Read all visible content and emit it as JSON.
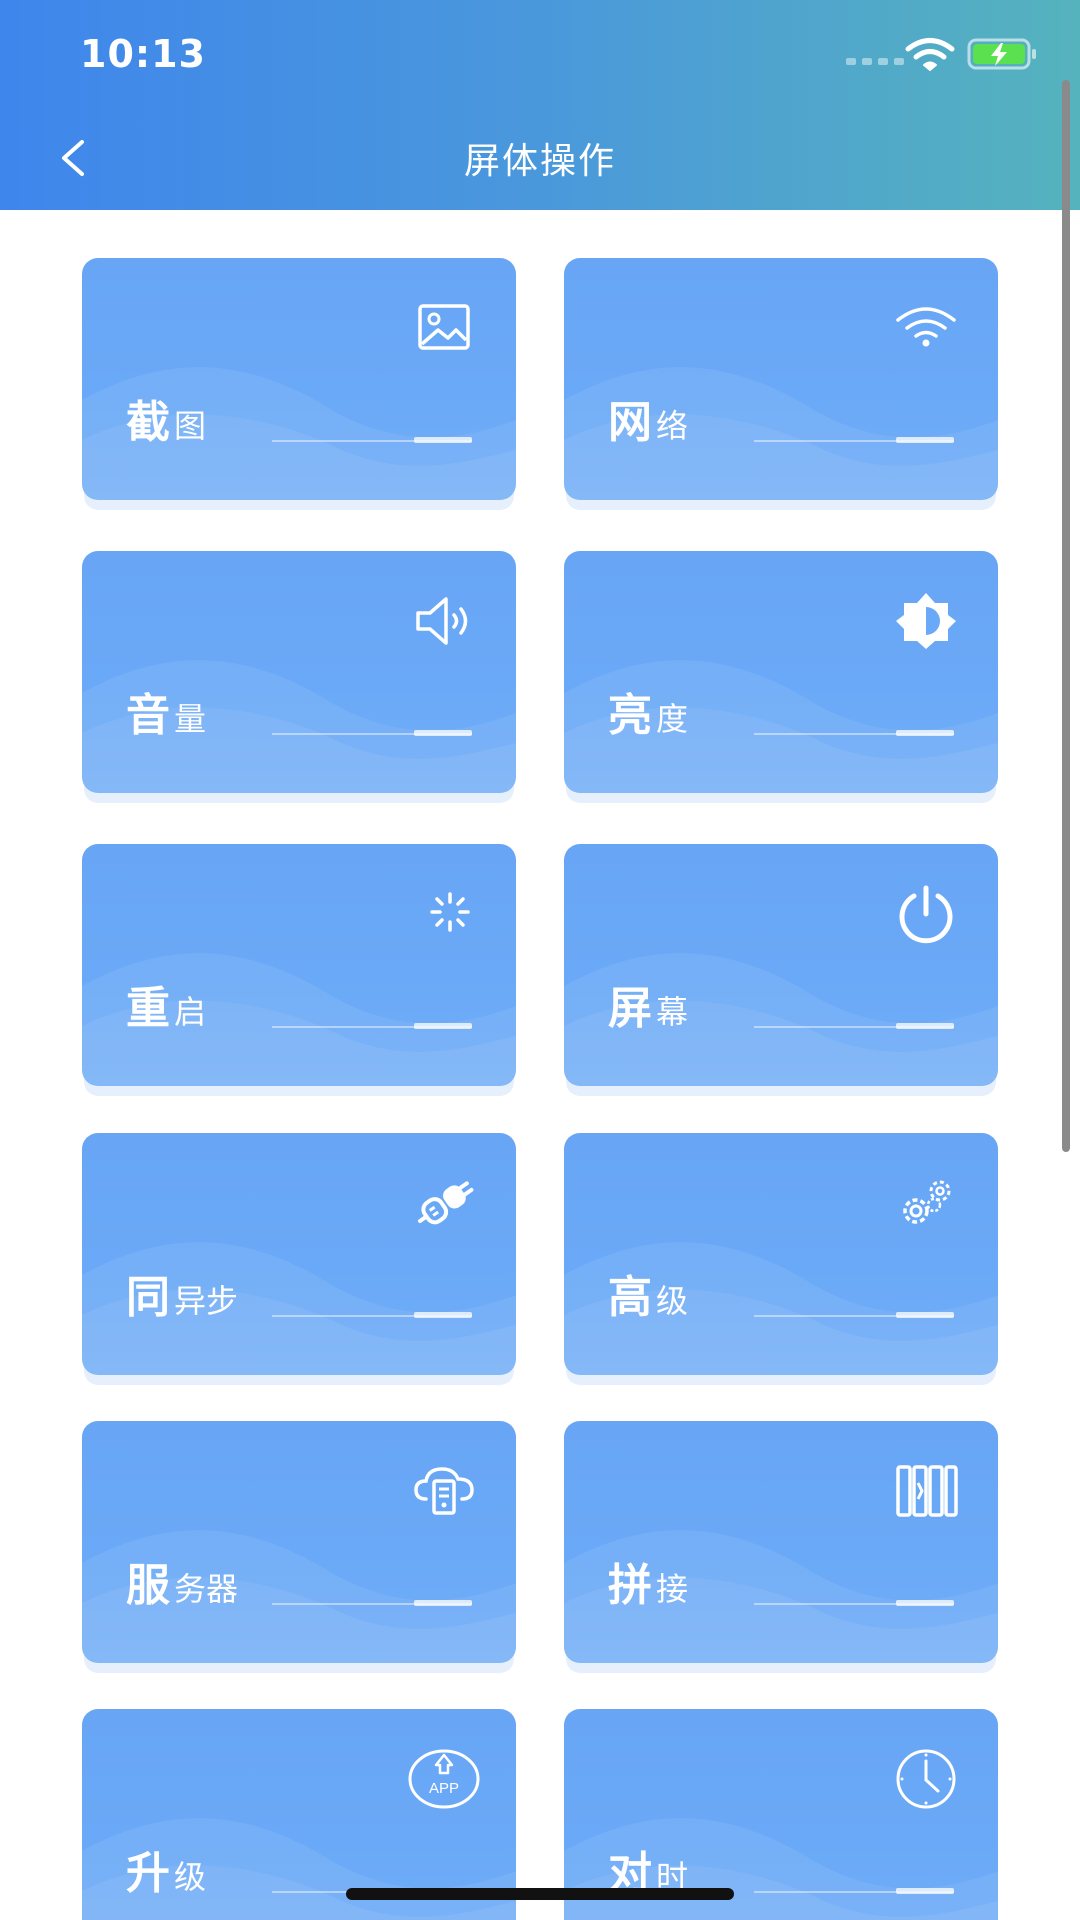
{
  "status_bar": {
    "time": "10:13"
  },
  "header": {
    "title": "屏体操作"
  },
  "cards": [
    {
      "main": "截",
      "rest": "图",
      "icon": "image-icon"
    },
    {
      "main": "网",
      "rest": "络",
      "icon": "wifi-icon"
    },
    {
      "main": "音",
      "rest": "量",
      "icon": "speaker-icon"
    },
    {
      "main": "亮",
      "rest": "度",
      "icon": "brightness-icon"
    },
    {
      "main": "重",
      "rest": "启",
      "icon": "loading-spinner-icon"
    },
    {
      "main": "屏",
      "rest": "幕",
      "icon": "power-icon"
    },
    {
      "main": "同",
      "rest": "异步",
      "icon": "plug-icon"
    },
    {
      "main": "高",
      "rest": "级",
      "icon": "gears-icon"
    },
    {
      "main": "服",
      "rest": "务器",
      "icon": "cloud-server-icon"
    },
    {
      "main": "拼",
      "rest": "接",
      "icon": "splice-panels-icon"
    },
    {
      "main": "升",
      "rest": "级",
      "icon": "app-upgrade-icon",
      "icon_text": "APP"
    },
    {
      "main": "对",
      "rest": "时",
      "icon": "clock-icon"
    }
  ]
}
